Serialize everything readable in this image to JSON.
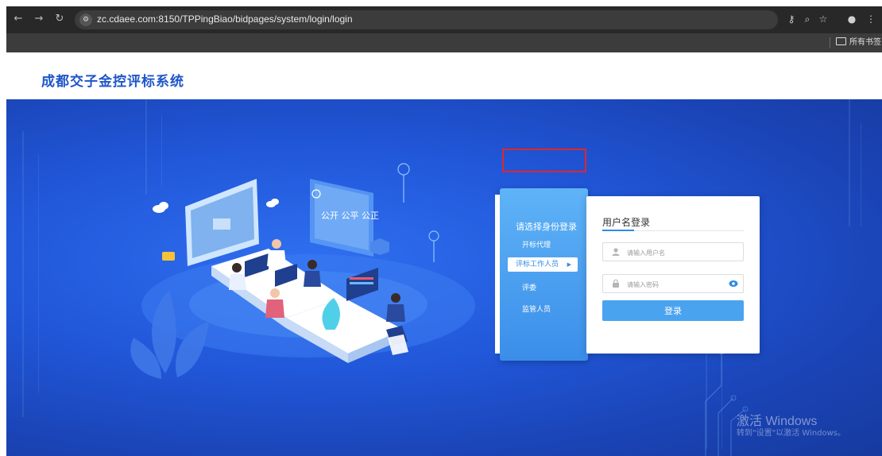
{
  "browser": {
    "url": "zc.cdaee.com:8150/TPPingBiao/bidpages/system/login/login",
    "bookmark_folder": "所有书签"
  },
  "page": {
    "title": "成都交子金控评标系统"
  },
  "illustration": {
    "sign_text": "公开 公平 公正"
  },
  "login": {
    "role_title": "请选择身份登录",
    "roles": [
      "开标代理",
      "评标工作人员",
      "评委",
      "监管人员"
    ],
    "active_role_index": 1,
    "form_title": "用户名登录",
    "username_placeholder": "请输入用户名",
    "password_placeholder": "请输入密码",
    "submit_label": "登录"
  },
  "watermark": {
    "line1": "激活 Windows",
    "line2": "转到\"设置\"以激活 Windows。"
  },
  "colors": {
    "accent": "#2f8be6",
    "title": "#1f56c9",
    "hero_bg": "#2157d9",
    "highlight": "#e0262b"
  }
}
